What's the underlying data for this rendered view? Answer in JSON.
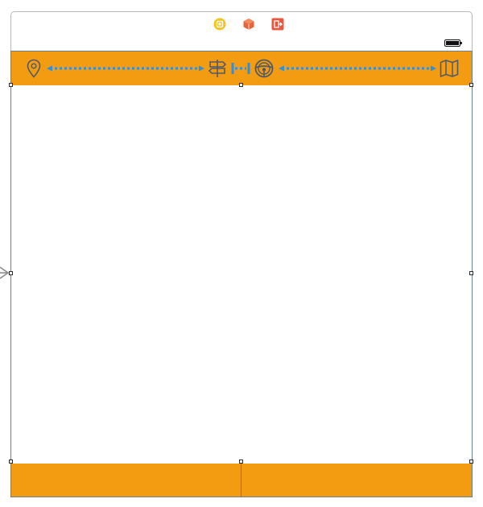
{
  "colors": {
    "accent": "#f39c12",
    "connector": "#2d8fe0",
    "icon_stroke": "#515a66",
    "frame_border": "#6a7f94"
  },
  "dock": {
    "icons": [
      "view-controller-icon",
      "first-responder-icon",
      "exit-icon"
    ]
  },
  "status_bar": {
    "icons": [
      "battery-icon"
    ]
  },
  "progress_strip": {
    "steps": [
      "location-pin-icon",
      "signpost-icon",
      "steering-wheel-icon",
      "map-icon"
    ],
    "connectors": [
      "dotted-double-arrow",
      "short-range-arrow",
      "dotted-double-arrow"
    ]
  },
  "bottom_bar": {
    "panes": [
      "left-pane",
      "right-pane"
    ]
  }
}
